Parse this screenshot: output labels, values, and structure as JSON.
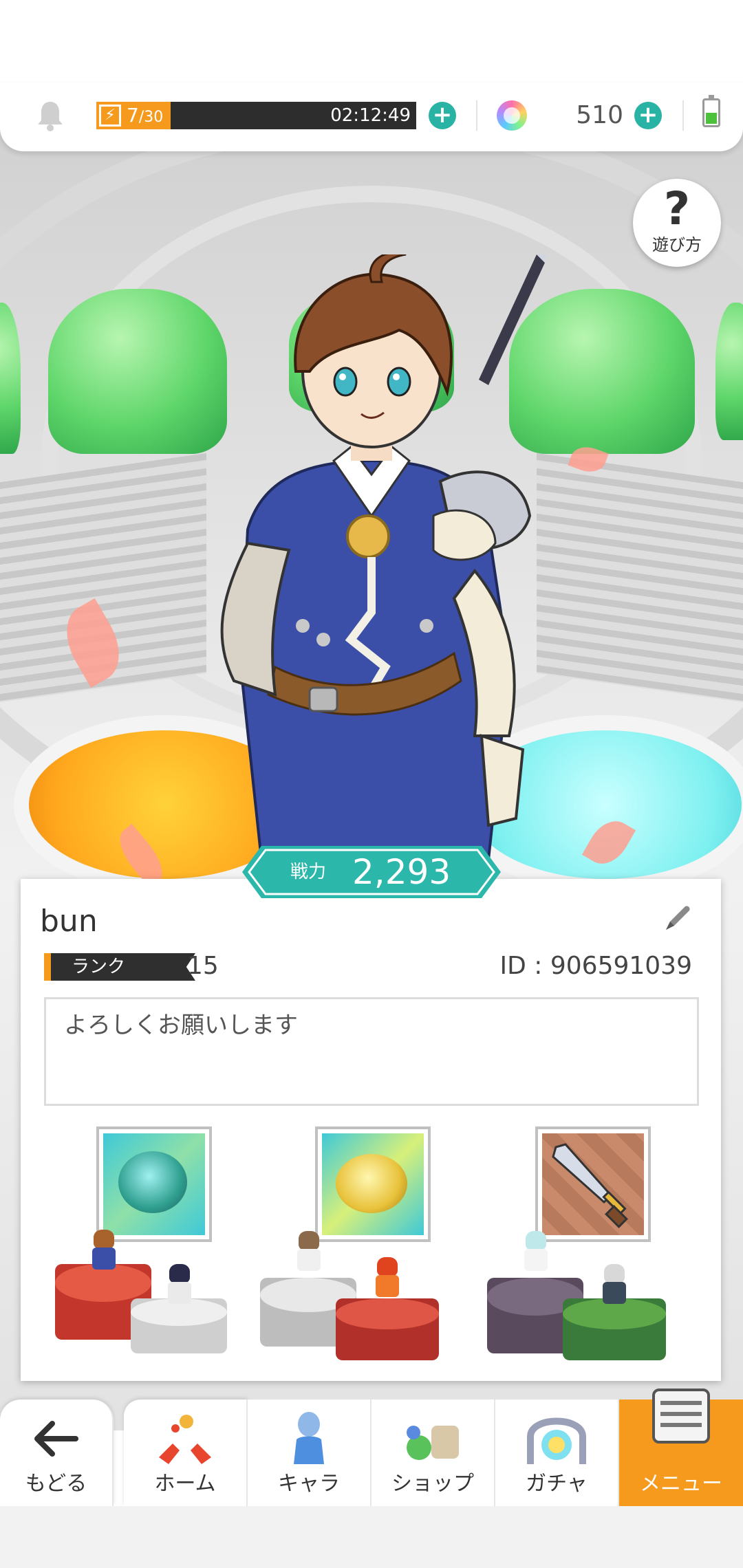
{
  "header": {
    "stamina_current": "7",
    "stamina_max": "/30",
    "stamina_fraction": 0.2333,
    "stamina_timer": "02:12:49",
    "gem_count": "510",
    "battery_level": 0.45
  },
  "help": {
    "label": "遊び方"
  },
  "profile": {
    "power_label": "戦力",
    "power_value": "2,293",
    "player_name": "bun",
    "rank_label": "ランク",
    "rank_value": "15",
    "player_id": "ID : 906591039",
    "comment": "よろしくお願いします"
  },
  "parties": [
    {
      "weapon_icon": "green-orb-weapon-icon"
    },
    {
      "weapon_icon": "gold-orb-weapon-icon"
    },
    {
      "weapon_icon": "sword-weapon-icon"
    }
  ],
  "nav": {
    "back": "もどる",
    "home": "ホーム",
    "chara": "キャラ",
    "shop": "ショップ",
    "gacha": "ガチャ",
    "menu": "メニュー"
  },
  "colors": {
    "accent_orange": "#f59a1c",
    "accent_teal": "#28b3a4",
    "power_badge": "#2bb7aa"
  }
}
